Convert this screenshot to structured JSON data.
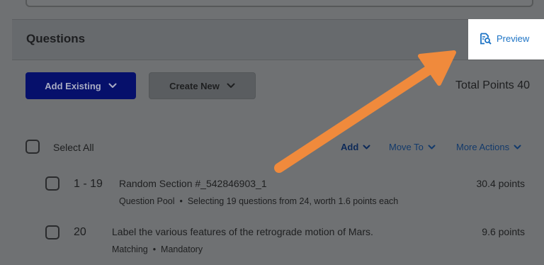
{
  "questions": {
    "title": "Questions",
    "preview_label": "Preview",
    "add_existing_label": "Add Existing",
    "create_new_label": "Create New",
    "total_points": "Total Points 40",
    "select_all_label": "Select All",
    "actions": {
      "add": "Add",
      "move_to": "Move To",
      "more_actions": "More Actions"
    },
    "rows": [
      {
        "number": "1 - 19",
        "title": "Random Section #_542846903_1",
        "type": "Question Pool",
        "detail": "Selecting 19 questions from 24, worth 1.6 points each",
        "points": "30.4 points"
      },
      {
        "number": "20",
        "title": "Label the various features of the retrograde motion of Mars.",
        "type": "Matching",
        "detail": "Mandatory",
        "points": "9.6 points"
      }
    ]
  },
  "colors": {
    "overlay": "#6f7173",
    "preview_link": "#1c73c5",
    "annotation_arrow": "#f08a3c",
    "primary_button": "#06106b"
  },
  "icons": {
    "preview": "preview-icon",
    "chevron": "chevron-down-icon"
  }
}
